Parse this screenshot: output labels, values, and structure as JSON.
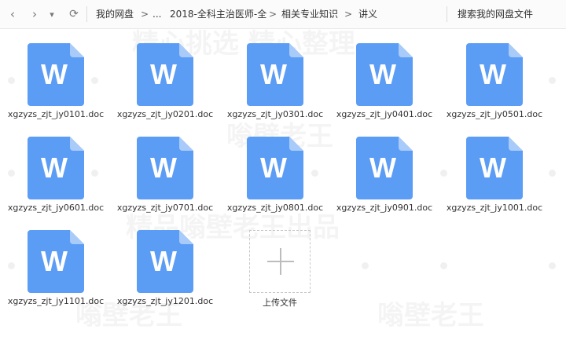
{
  "nav": {
    "back_glyph": "‹",
    "forward_glyph": "›",
    "dropdown_glyph": "▾",
    "refresh_glyph": "⟳"
  },
  "breadcrumb": {
    "items": [
      "我的网盘",
      "...",
      "2018-全科主治医师-全",
      "相关专业知识",
      "讲义"
    ],
    "separator": ">"
  },
  "search": {
    "placeholder": "搜索我的网盘文件"
  },
  "files": [
    {
      "name": "xgzyzs_zjt_jy0101.doc",
      "icon": "word-doc-icon"
    },
    {
      "name": "xgzyzs_zjt_jy0201.doc",
      "icon": "word-doc-icon"
    },
    {
      "name": "xgzyzs_zjt_jy0301.doc",
      "icon": "word-doc-icon"
    },
    {
      "name": "xgzyzs_zjt_jy0401.doc",
      "icon": "word-doc-icon"
    },
    {
      "name": "xgzyzs_zjt_jy0501.doc",
      "icon": "word-doc-icon"
    },
    {
      "name": "xgzyzs_zjt_jy0601.doc",
      "icon": "word-doc-icon"
    },
    {
      "name": "xgzyzs_zjt_jy0701.doc",
      "icon": "word-doc-icon"
    },
    {
      "name": "xgzyzs_zjt_jy0801.doc",
      "icon": "word-doc-icon"
    },
    {
      "name": "xgzyzs_zjt_jy0901.doc",
      "icon": "word-doc-icon"
    },
    {
      "name": "xgzyzs_zjt_jy1001.doc",
      "icon": "word-doc-icon"
    },
    {
      "name": "xgzyzs_zjt_jy1101.doc",
      "icon": "word-doc-icon"
    },
    {
      "name": "xgzyzs_zjt_jy1201.doc",
      "icon": "word-doc-icon"
    }
  ],
  "doc_letter": "W",
  "upload": {
    "label": "上传文件"
  },
  "watermarks": [
    "精心挑选 精心整理",
    "嗡壁老王",
    "精品嗡壁老王出品",
    "嗡壁老王",
    "嗡壁老王"
  ],
  "colors": {
    "doc_blue": "#5b9cf5",
    "doc_fold": "#a9cbfa"
  }
}
